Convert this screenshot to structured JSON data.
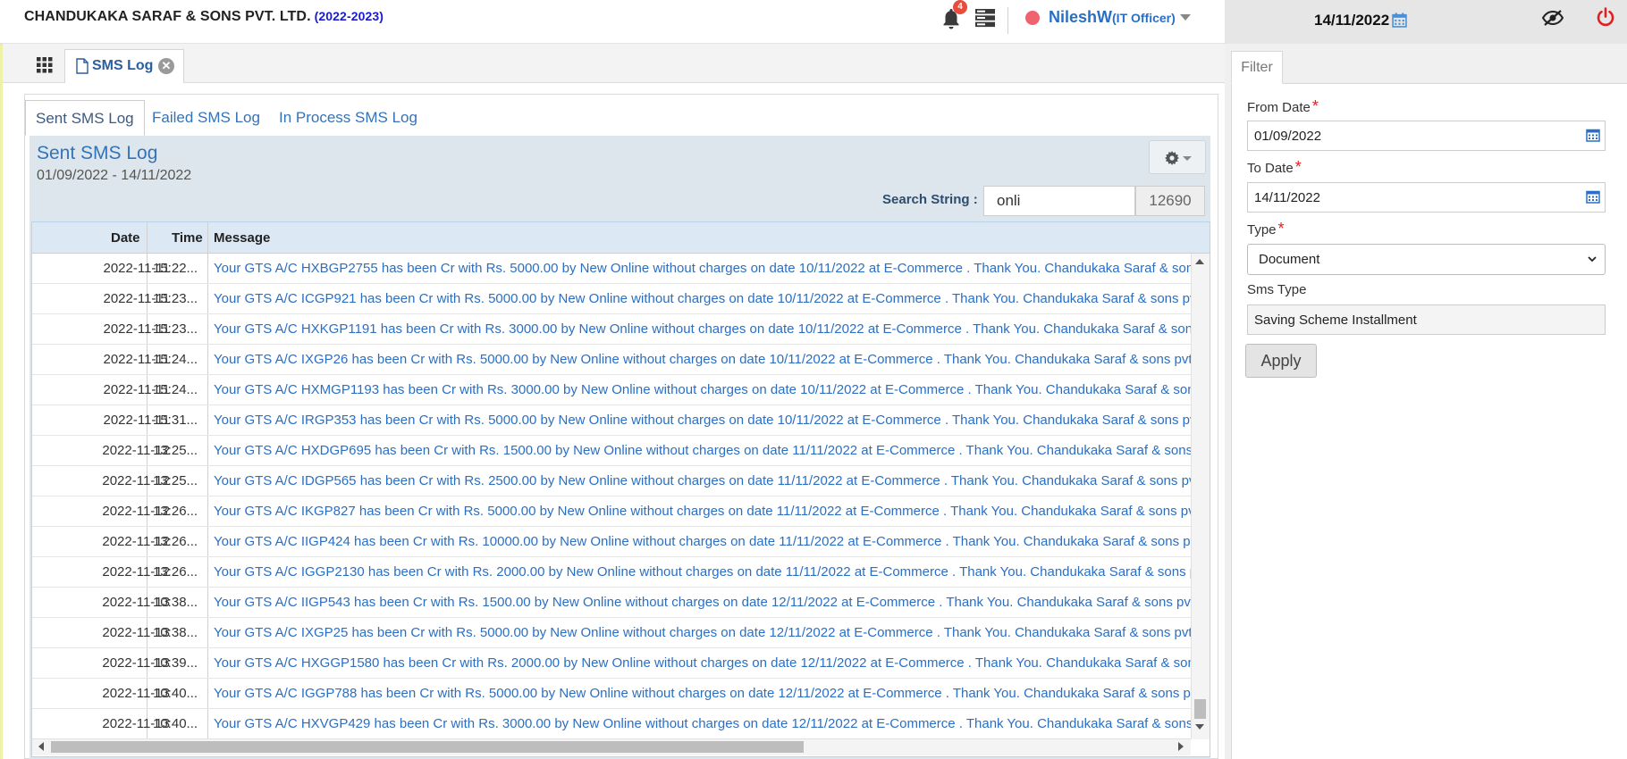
{
  "header": {
    "company": "CHANDUKAKA SARAF & SONS PVT. LTD.",
    "year": "(2022-2023)",
    "notification_count": "4",
    "user_name": "NileshW",
    "user_role": "(IT Officer)",
    "date": "14/11/2022",
    "status_color": "#f0626e"
  },
  "tabs": {
    "open_tab": "SMS Log",
    "close_glyph": "✕"
  },
  "subtabs": [
    "Sent SMS Log",
    "Failed SMS Log",
    "In Process SMS Log"
  ],
  "list": {
    "title": "Sent SMS Log",
    "range": "01/09/2022 - 14/11/2022",
    "search_label": "Search String :",
    "search_value": "onli",
    "count": "12690"
  },
  "columns": [
    "Date",
    "Time",
    "Message"
  ],
  "rows": [
    {
      "date": "2022-11-11",
      "time": "15:22...",
      "message": "Your GTS A/C HXBGP2755 has been Cr with Rs. 5000.00 by New Online without charges on date 10/11/2022 at E-Commerce . Thank You. Chandukaka Saraf & sons pvt ltd"
    },
    {
      "date": "2022-11-11",
      "time": "15:23...",
      "message": "Your GTS A/C ICGP921 has been Cr with Rs. 5000.00 by New Online without charges on date 10/11/2022 at E-Commerce . Thank You. Chandukaka Saraf & sons pvt ltd"
    },
    {
      "date": "2022-11-11",
      "time": "15:23...",
      "message": "Your GTS A/C HXKGP1191 has been Cr with Rs. 3000.00 by New Online without charges on date 10/11/2022 at E-Commerce . Thank You. Chandukaka Saraf & sons pvt ltd"
    },
    {
      "date": "2022-11-11",
      "time": "15:24...",
      "message": "Your GTS A/C IXGP26 has been Cr with Rs. 5000.00 by New Online without charges on date 10/11/2022 at E-Commerce . Thank You. Chandukaka Saraf & sons pvt ltd"
    },
    {
      "date": "2022-11-11",
      "time": "15:24...",
      "message": "Your GTS A/C HXMGP1193 has been Cr with Rs. 3000.00 by New Online without charges on date 10/11/2022 at E-Commerce . Thank You. Chandukaka Saraf & sons pvt ltd"
    },
    {
      "date": "2022-11-11",
      "time": "15:31...",
      "message": "Your GTS A/C IRGP353 has been Cr with Rs. 5000.00 by New Online without charges on date 10/11/2022 at E-Commerce . Thank You. Chandukaka Saraf & sons pvt ltd"
    },
    {
      "date": "2022-11-12",
      "time": "13:25...",
      "message": "Your GTS A/C HXDGP695 has been Cr with Rs. 1500.00 by New Online without charges on date 11/11/2022 at E-Commerce . Thank You. Chandukaka Saraf & sons pvt ltd"
    },
    {
      "date": "2022-11-12",
      "time": "13:25...",
      "message": "Your GTS A/C IDGP565 has been Cr with Rs. 2500.00 by New Online without charges on date 11/11/2022 at E-Commerce . Thank You. Chandukaka Saraf & sons pvt ltd"
    },
    {
      "date": "2022-11-12",
      "time": "13:26...",
      "message": "Your GTS A/C IKGP827 has been Cr with Rs. 5000.00 by New Online without charges on date 11/11/2022 at E-Commerce . Thank You. Chandukaka Saraf & sons pvt ltd"
    },
    {
      "date": "2022-11-12",
      "time": "13:26...",
      "message": "Your GTS A/C IIGP424 has been Cr with Rs. 10000.00 by New Online without charges on date 11/11/2022 at E-Commerce . Thank You. Chandukaka Saraf & sons pvt ltd"
    },
    {
      "date": "2022-11-12",
      "time": "13:26...",
      "message": "Your GTS A/C IGGP2130 has been Cr with Rs. 2000.00 by New Online without charges on date 11/11/2022 at E-Commerce . Thank You. Chandukaka Saraf & sons pvt ltd"
    },
    {
      "date": "2022-11-13",
      "time": "10:38...",
      "message": "Your GTS A/C IIGP543 has been Cr with Rs. 1500.00 by New Online without charges on date 12/11/2022 at E-Commerce . Thank You. Chandukaka Saraf & sons pvt ltd"
    },
    {
      "date": "2022-11-13",
      "time": "10:38...",
      "message": "Your GTS A/C IXGP25 has been Cr with Rs. 5000.00 by New Online without charges on date 12/11/2022 at E-Commerce . Thank You. Chandukaka Saraf & sons pvt ltd"
    },
    {
      "date": "2022-11-13",
      "time": "10:39...",
      "message": "Your GTS A/C HXGGP1580 has been Cr with Rs. 2000.00 by New Online without charges on date 12/11/2022 at E-Commerce . Thank You. Chandukaka Saraf & sons pvt ltd"
    },
    {
      "date": "2022-11-13",
      "time": "10:40...",
      "message": "Your GTS A/C IGGP788 has been Cr with Rs. 5000.00 by New Online without charges on date 12/11/2022 at E-Commerce . Thank You. Chandukaka Saraf & sons pvt ltd"
    },
    {
      "date": "2022-11-13",
      "time": "10:40...",
      "message": "Your GTS A/C HXVGP429 has been Cr with Rs. 3000.00 by New Online without charges on date 12/11/2022 at E-Commerce . Thank You. Chandukaka Saraf & sons pvt ltd"
    }
  ],
  "filter": {
    "tab_label": "Filter",
    "from_label": "From Date",
    "from_value": "01/09/2022",
    "to_label": "To Date",
    "to_value": "14/11/2022",
    "type_label": "Type",
    "type_value": "Document",
    "type_options": [
      "Document"
    ],
    "sms_type_label": "Sms Type",
    "sms_type_value": "Saving Scheme Installment",
    "apply_label": "Apply",
    "required_mark": "*"
  },
  "colors": {
    "accent": "#3573b7",
    "link": "#2a6fc4",
    "required": "#e02020",
    "power": "#e02020"
  }
}
